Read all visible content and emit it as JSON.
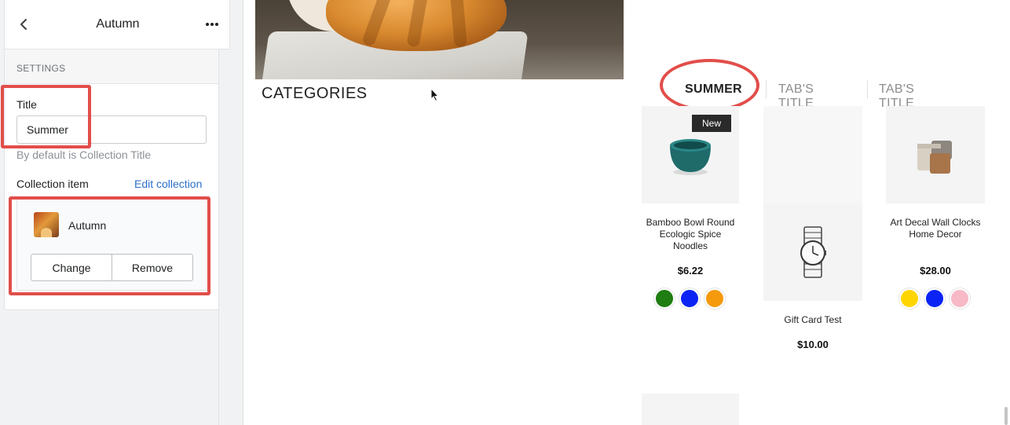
{
  "panel": {
    "title": "Autumn",
    "back_icon": "chevron-left-icon",
    "more_icon": "more-horizontal-icon",
    "section_label": "SETTINGS",
    "title_field": {
      "label": "Title",
      "value": "Summer",
      "help": "By default is Collection Title"
    },
    "collection": {
      "label": "Collection item",
      "edit_link": "Edit collection",
      "item_name": "Autumn",
      "change_label": "Change",
      "remove_label": "Remove"
    }
  },
  "preview": {
    "categories_heading": "CATEGORIES",
    "tabs": [
      {
        "label": "SUMMER",
        "active": true
      },
      {
        "label": "TAB'S TITLE",
        "active": false
      },
      {
        "label": "TAB'S TITLE",
        "active": false
      }
    ],
    "products": [
      {
        "name": "Bamboo Bowl Round Ecologic Spice Noodles",
        "price": "$6.22",
        "badge": "New",
        "swatches": [
          "#1f7d12",
          "#0b24f5",
          "#f59a0c"
        ]
      },
      {
        "name": "Gift Card Test",
        "price": "$10.00",
        "badge": "",
        "swatches": []
      },
      {
        "name": "Art Decal Wall Clocks Home Decor",
        "price": "$28.00",
        "badge": "",
        "swatches": [
          "#ffd500",
          "#0b24f5",
          "#f7b9c6"
        ]
      }
    ]
  },
  "colors": {
    "accent_link": "#2c6ecb",
    "highlight": "#e24e4a",
    "badge_bg": "#2a2a2a"
  }
}
